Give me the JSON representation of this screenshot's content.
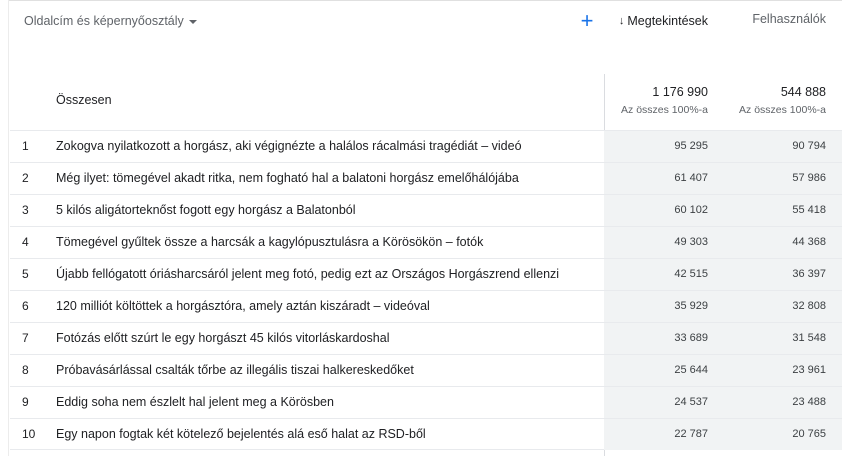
{
  "header": {
    "dimension_label": "Oldalcím és képernyőosztály",
    "add_icon": "+",
    "sort_arrow": "↓",
    "col_views": "Megtekintések",
    "col_users": "Felhasználók"
  },
  "totals": {
    "label": "Összesen",
    "views": "1 176 990",
    "views_sub": "Az összes 100%-a",
    "users": "544 888",
    "users_sub": "Az összes 100%-a"
  },
  "rows": [
    {
      "idx": "1",
      "title": "Zokogva nyilatkozott a horgász, aki végignézte a halálos rácalmási tragédiát – videó",
      "views": "95 295",
      "users": "90 794"
    },
    {
      "idx": "2",
      "title": "Még ilyet: tömegével akadt ritka, nem fogható hal a balatoni horgász emelőhálójába",
      "views": "61 407",
      "users": "57 986"
    },
    {
      "idx": "3",
      "title": "5 kilós aligátorteknőst fogott egy horgász a Balatonból",
      "views": "60 102",
      "users": "55 418"
    },
    {
      "idx": "4",
      "title": "Tömegével gyűltek össze a harcsák a kagylópusztulásra a Körösökön – fotók",
      "views": "49 303",
      "users": "44 368"
    },
    {
      "idx": "5",
      "title": "Újabb fellógatott óriásharcsáról jelent meg fotó, pedig ezt az Országos Horgászrend ellenzi",
      "views": "42 515",
      "users": "36 397"
    },
    {
      "idx": "6",
      "title": "120 milliót költöttek a horgásztóra, amely aztán kiszáradt – videóval",
      "views": "35 929",
      "users": "32 808"
    },
    {
      "idx": "7",
      "title": "Fotózás előtt szúrt le egy horgászt 45 kilós vitorláskardoshal",
      "views": "33 689",
      "users": "31 548"
    },
    {
      "idx": "8",
      "title": "Próbavásárlással csalták tőrbe az illegális tiszai halkereskedőket",
      "views": "25 644",
      "users": "23 961"
    },
    {
      "idx": "9",
      "title": "Eddig soha nem észlelt hal jelent meg a Körösben",
      "views": "24 537",
      "users": "23 488"
    },
    {
      "idx": "10",
      "title": "Egy napon fogtak két kötelező bejelentés alá eső halat az RSD-ből",
      "views": "22 787",
      "users": "20 765"
    }
  ]
}
